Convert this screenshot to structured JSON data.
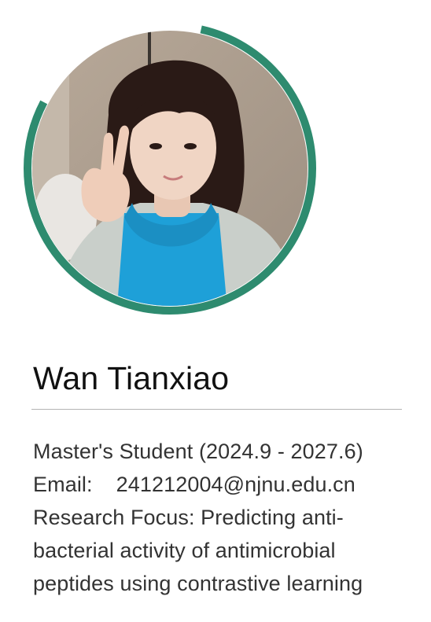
{
  "profile": {
    "name": "Wan Tianxiao",
    "role": "Master's Student (2024.9 - 2027.6)",
    "email_label": "Email:",
    "email": "241212004@njnu.edu.cn",
    "research_line1": "Research Focus: Predicting anti-",
    "research_line2": "bacterial activity of antimicrobial",
    "research_line3": "peptides using contrastive learning"
  },
  "colors": {
    "accent_ring": "#2e8b6f",
    "background": "#ffffff",
    "divider": "#b4b4b4",
    "shirt": "#1ea0d8"
  },
  "icons": {
    "portrait": "person-photo"
  }
}
